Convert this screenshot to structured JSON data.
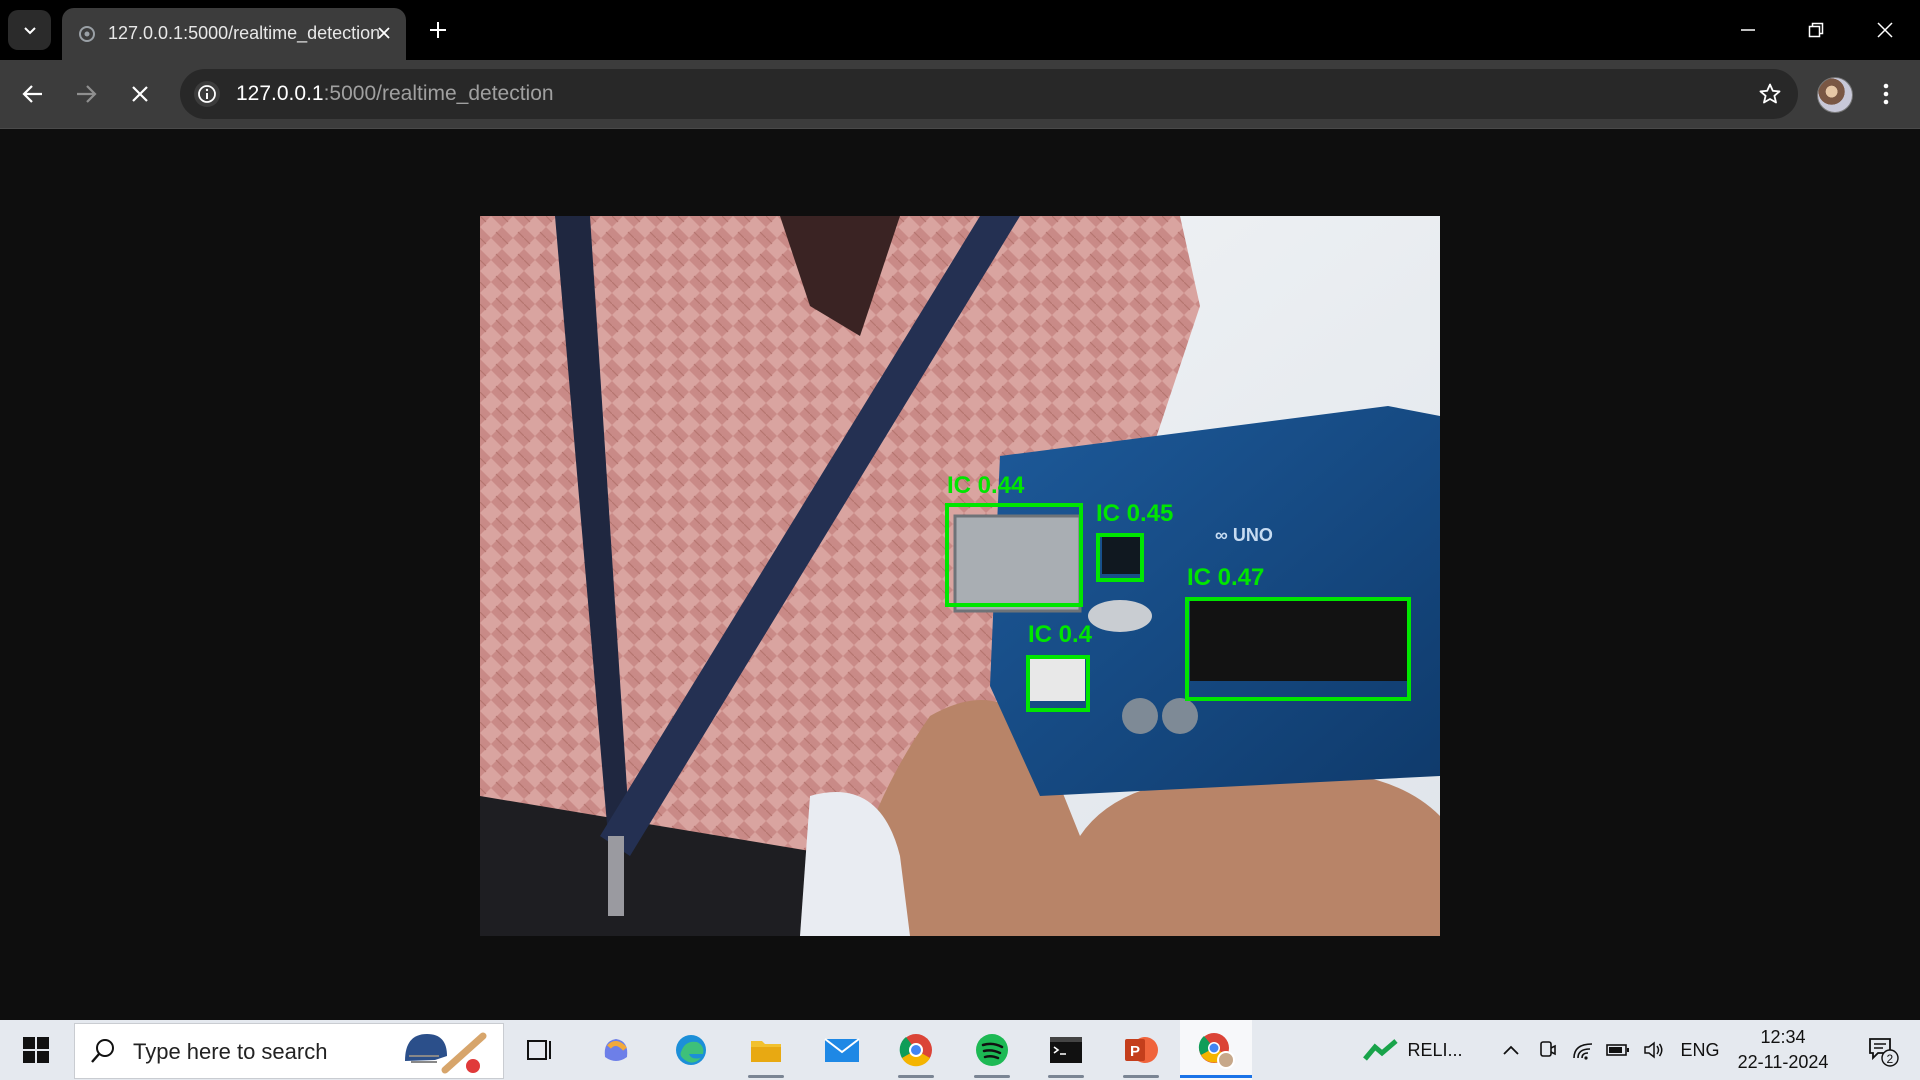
{
  "browser": {
    "tab": {
      "title": "127.0.0.1:5000/realtime_detection"
    },
    "url": {
      "host": "127.0.0.1",
      "path": ":5000/realtime_detection"
    }
  },
  "detections": [
    {
      "label": "IC 0.44"
    },
    {
      "label": "IC 0.45"
    },
    {
      "label": "IC 0.47"
    },
    {
      "label": "IC 0.4"
    }
  ],
  "detection_color": "#00e600",
  "taskbar": {
    "search_placeholder": "Type here to search",
    "tray": {
      "stock_label": "RELI...",
      "language": "ENG",
      "time": "12:34",
      "date": "22-11-2024",
      "notification_count": "2"
    }
  },
  "icons": [
    "tab-search-icon",
    "globe-favicon-icon",
    "close-icon",
    "plus-icon",
    "minimize-icon",
    "restore-icon",
    "window-close-icon",
    "back-arrow-icon",
    "forward-arrow-icon",
    "stop-loading-icon",
    "info-icon",
    "star-icon",
    "profile-avatar",
    "kebab-menu-icon",
    "windows-start-icon",
    "search-icon",
    "task-view-icon",
    "copilot-icon",
    "edge-icon",
    "file-explorer-icon",
    "mail-icon",
    "chrome-icon",
    "spotify-icon",
    "terminal-icon",
    "powerpoint-icon",
    "chrome-profile-icon",
    "stock-chart-icon",
    "chevron-up-icon",
    "meet-icon",
    "wifi-icon",
    "battery-icon",
    "volume-icon",
    "notification-icon"
  ]
}
